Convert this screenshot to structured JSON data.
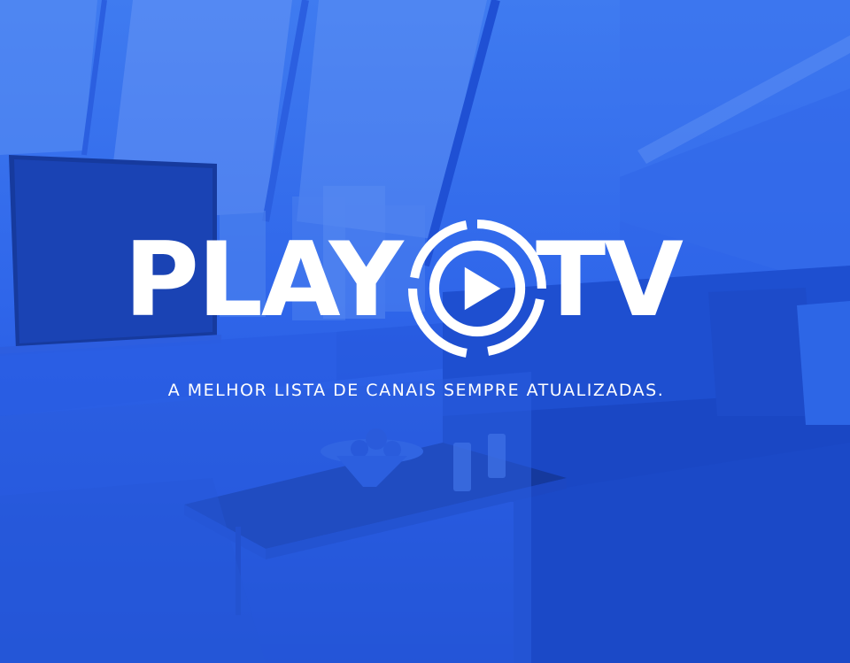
{
  "brand": {
    "word_left": "PLAY",
    "word_right": "TV",
    "mark_icon": "play-circle-icon"
  },
  "tagline": "A MELHOR LISTA DE CANAIS SEMPRE ATUALIZADAS.",
  "colors": {
    "overlay": "#2f66ea",
    "text": "#ffffff"
  }
}
